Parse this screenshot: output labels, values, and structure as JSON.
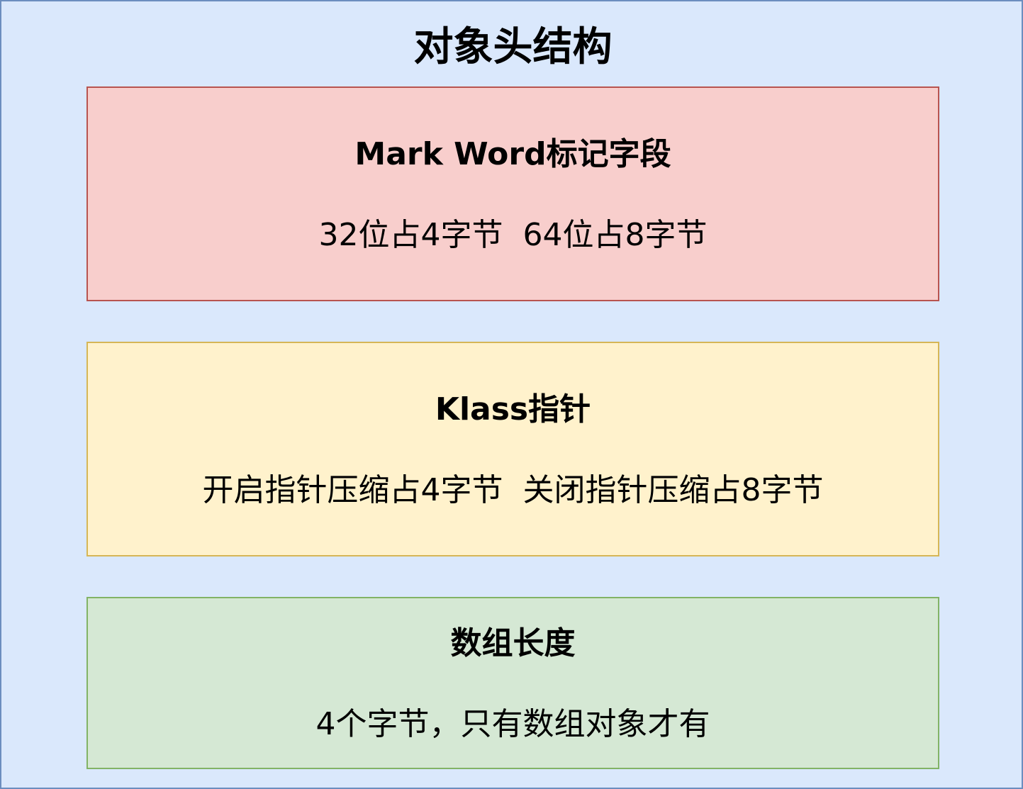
{
  "diagram": {
    "title": "对象头结构",
    "blocks": [
      {
        "title": "Mark Word标记字段",
        "description": "32位占4字节  64位占8字节",
        "fill": "#f8cecc",
        "stroke": "#b85450"
      },
      {
        "title": "Klass指针",
        "description": "开启指针压缩占4字节  关闭指针压缩占8字节",
        "fill": "#fff2cc",
        "stroke": "#d6b656"
      },
      {
        "title": "数组长度",
        "description": "4个字节，只有数组对象才有",
        "fill": "#d5e8d4",
        "stroke": "#82b366"
      }
    ],
    "container": {
      "fill": "#dae8fc",
      "stroke": "#6c8ebf"
    }
  }
}
